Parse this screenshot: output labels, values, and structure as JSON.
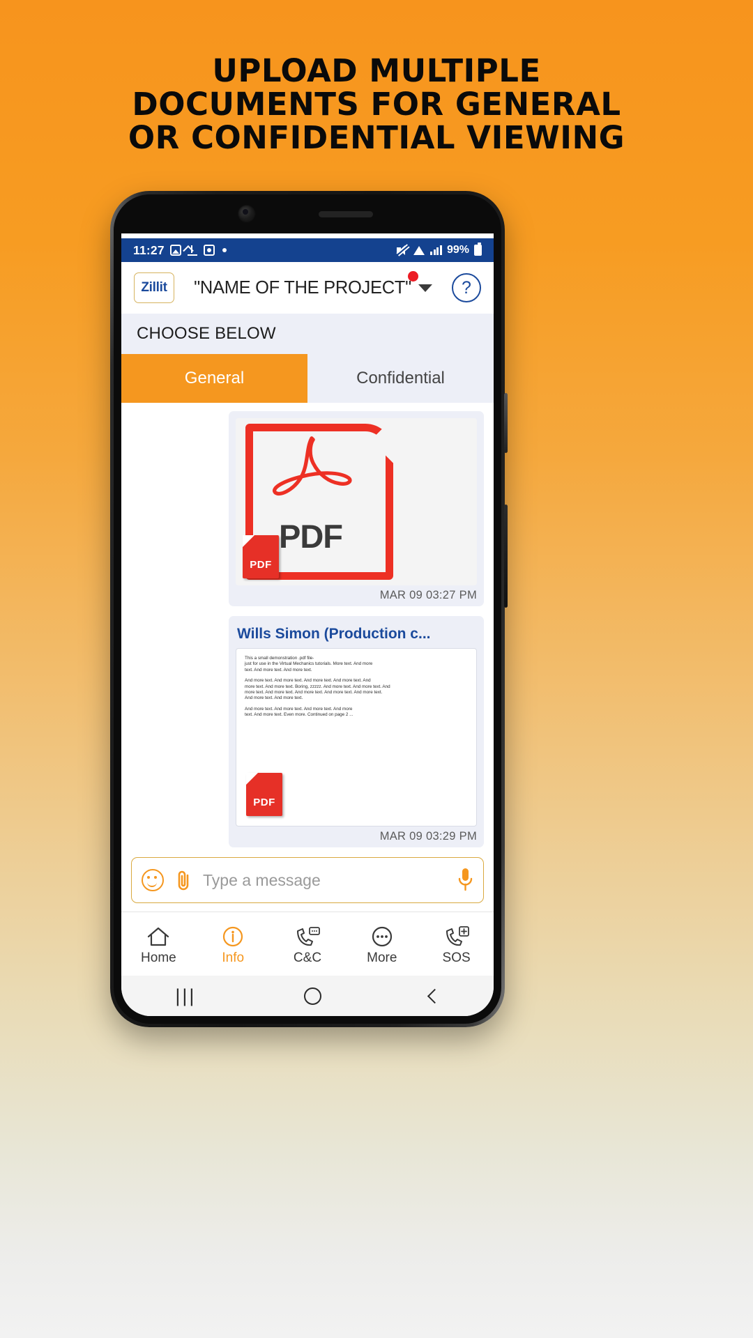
{
  "headline": {
    "line1": "UPLOAD MULTIPLE",
    "line2": "DOCUMENTS FOR GENERAL",
    "line3": "OR CONFIDENTIAL VIEWING"
  },
  "statusbar": {
    "time": "11:27",
    "battery": "99%",
    "icons_left": [
      "photo-icon",
      "upload-icon",
      "screenshot-icon",
      "dot-icon"
    ],
    "icons_right": [
      "mute-icon",
      "wifi-icon",
      "signal-icon",
      "battery-icon"
    ]
  },
  "appbar": {
    "logo": "Zillit",
    "project_title": "\"NAME OF THE PROJECT\"",
    "help": "?",
    "dropdown_icon": "chevron-down-icon",
    "notification_badge": ""
  },
  "choose": {
    "label": "CHOOSE BELOW"
  },
  "tabs": [
    {
      "label": "General",
      "active": true
    },
    {
      "label": "Confidential",
      "active": false
    }
  ],
  "messages": [
    {
      "type": "pdf-icon",
      "pdf_label": "PDF",
      "badge_label": "PDF",
      "timestamp": "MAR 09 03:27 PM"
    },
    {
      "type": "doc-preview",
      "title": "Wills Simon (Production c...",
      "badge_label": "PDF",
      "timestamp": "MAR 09 03:29 PM",
      "preview_lines": [
        "This a small demonstration .pdf file-",
        "just for use in the Virtual Mechanics tutorials. More text. And more",
        "text. And more text. And more text.",
        "And more text. And more text. And more text. And more text. And",
        "more text. And more text. Boring, zzzzz. And more text. And more text. And",
        "more text. And more text. And more text. And more text. And more text.",
        "And more text. And more text.",
        "And more text. And more text. And more text. And more",
        "text. And more text. Even more. Continued on page 2 ..."
      ]
    }
  ],
  "input": {
    "placeholder": "Type a message",
    "emoji_icon": "emoji-icon",
    "attach_icon": "paperclip-icon",
    "mic_icon": "microphone-icon"
  },
  "bottomnav": [
    {
      "label": "Home",
      "icon": "home-icon",
      "active": false
    },
    {
      "label": "Info",
      "icon": "info-icon",
      "active": true
    },
    {
      "label": "C&C",
      "icon": "call-chat-icon",
      "active": false
    },
    {
      "label": "More",
      "icon": "more-dots-icon",
      "active": false
    },
    {
      "label": "SOS",
      "icon": "sos-call-icon",
      "active": false
    }
  ],
  "sysbar": {
    "recent": "|||",
    "home_icon": "home-circle-icon",
    "back_icon": "back-chevron-icon"
  },
  "colors": {
    "brand_orange": "#F5971F",
    "brand_blue": "#1B4A9C",
    "status_blue": "#14428F",
    "pdf_red": "#ED3024",
    "panel": "#EDEFF7"
  }
}
